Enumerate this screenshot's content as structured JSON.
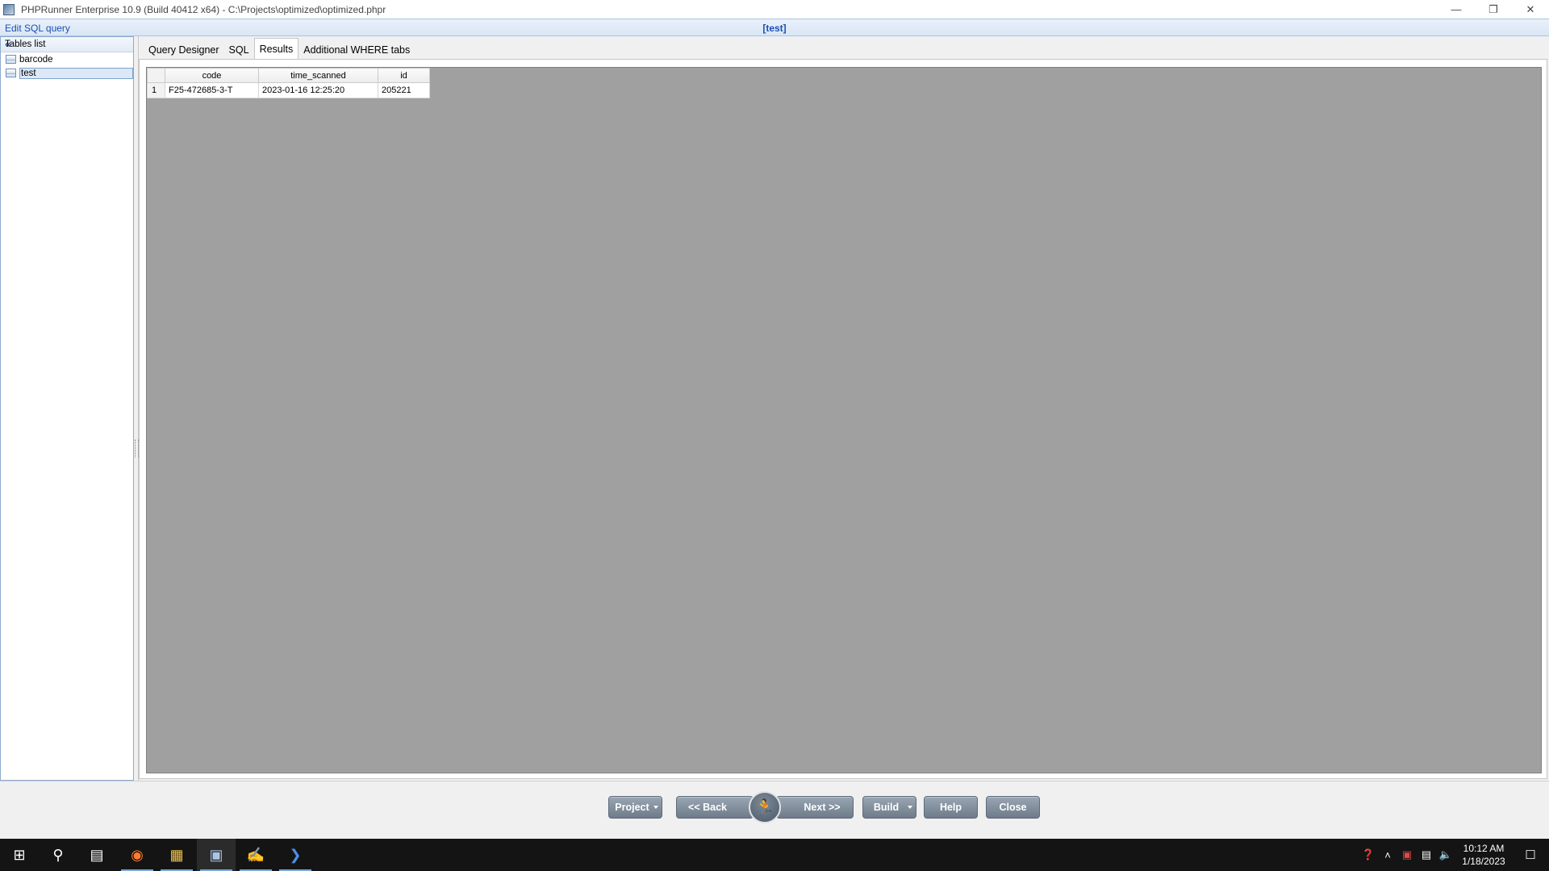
{
  "window": {
    "title": "PHPRunner Enterprise 10.9 (Build 40412 x64) - C:\\Projects\\optimized\\optimized.phpr",
    "minimize_icon": "minimize-icon",
    "restore_icon": "restore-icon",
    "close_icon": "close-icon"
  },
  "header": {
    "label": "Edit SQL query",
    "current_table": "[test]"
  },
  "tables_list": {
    "title": "Tables list",
    "collapse_icon": "«",
    "items": [
      {
        "label": "barcode",
        "selected": false
      },
      {
        "label": "test",
        "selected": true
      }
    ]
  },
  "tabs": [
    {
      "label": "Query Designer",
      "active": false
    },
    {
      "label": "SQL",
      "active": false
    },
    {
      "label": "Results",
      "active": true
    },
    {
      "label": "Additional WHERE tabs",
      "active": false
    }
  ],
  "results": {
    "columns": [
      "code",
      "time_scanned",
      "id"
    ],
    "rows": [
      {
        "num": "1",
        "code": "F25-472685-3-T",
        "time_scanned": "2023-01-16 12:25:20",
        "id": "205221"
      }
    ]
  },
  "buttons": {
    "project": "Project",
    "back": "<< Back",
    "next": "Next >>",
    "build": "Build",
    "help": "Help",
    "close": "Close"
  },
  "taskbar": {
    "items": [
      "start-icon",
      "search-icon",
      "task-view-icon",
      "firefox-icon",
      "file-explorer-icon",
      "phprunner-icon",
      "paint-icon",
      "powershell-icon"
    ],
    "clock_time": "10:12 AM",
    "clock_date": "1/18/2023"
  },
  "colors": {
    "accent_blue": "#1b4fb4",
    "grid_background": "#a0a0a0",
    "button_gray": "#7d8a98"
  }
}
